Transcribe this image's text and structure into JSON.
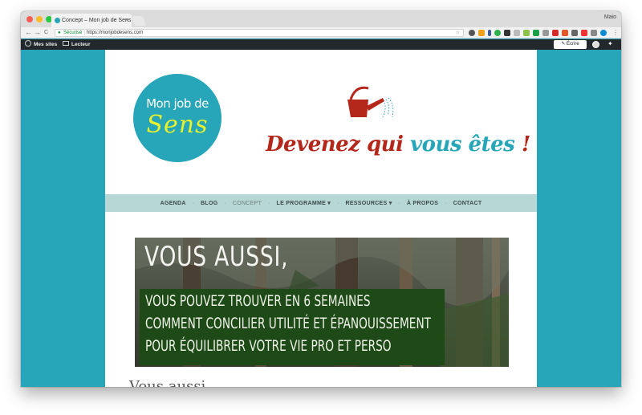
{
  "browser": {
    "tab_title": "Concept – Mon job de Sens",
    "tab_close": "×",
    "profile_name": "Maio",
    "back": "←",
    "forward": "→",
    "reload": "C",
    "home": "⌂",
    "secure_label": "Sécurisé",
    "url": "https://monjobdesens.com",
    "star": "☆"
  },
  "adminbar": {
    "sites": "Mes sites",
    "reader": "Lecteur",
    "write": "Écrire"
  },
  "header": {
    "logo_top": "Mon job de",
    "logo_bottom": "Sens",
    "tagline_part1": "Devenez qui ",
    "tagline_part2": "vous êtes",
    "tagline_part3": " !"
  },
  "nav": {
    "items": [
      {
        "label": "AGENDA"
      },
      {
        "label": "BLOG"
      },
      {
        "label": "CONCEPT"
      },
      {
        "label": "LE PROGRAMME ▾"
      },
      {
        "label": "RESSOURCES ▾"
      },
      {
        "label": "À PROPOS"
      },
      {
        "label": "CONTACT"
      }
    ]
  },
  "banner": {
    "headline": "VOUS AUSSI,",
    "line1": "VOUS POUVEZ TROUVER EN 6 SEMAINES",
    "line2": "COMMENT CONCILIER UTILITÉ ET ÉPANOUISSEMENT",
    "line3": "POUR ÉQUILIBRER VOTRE VIE PRO ET PERSO"
  },
  "content": {
    "title": "Vous aussi,"
  },
  "colors": {
    "brand_teal": "#27a5b9",
    "brand_red": "#b4271b",
    "nav_bg": "#b7d7d6",
    "logo_yellow": "#e9f22a"
  }
}
